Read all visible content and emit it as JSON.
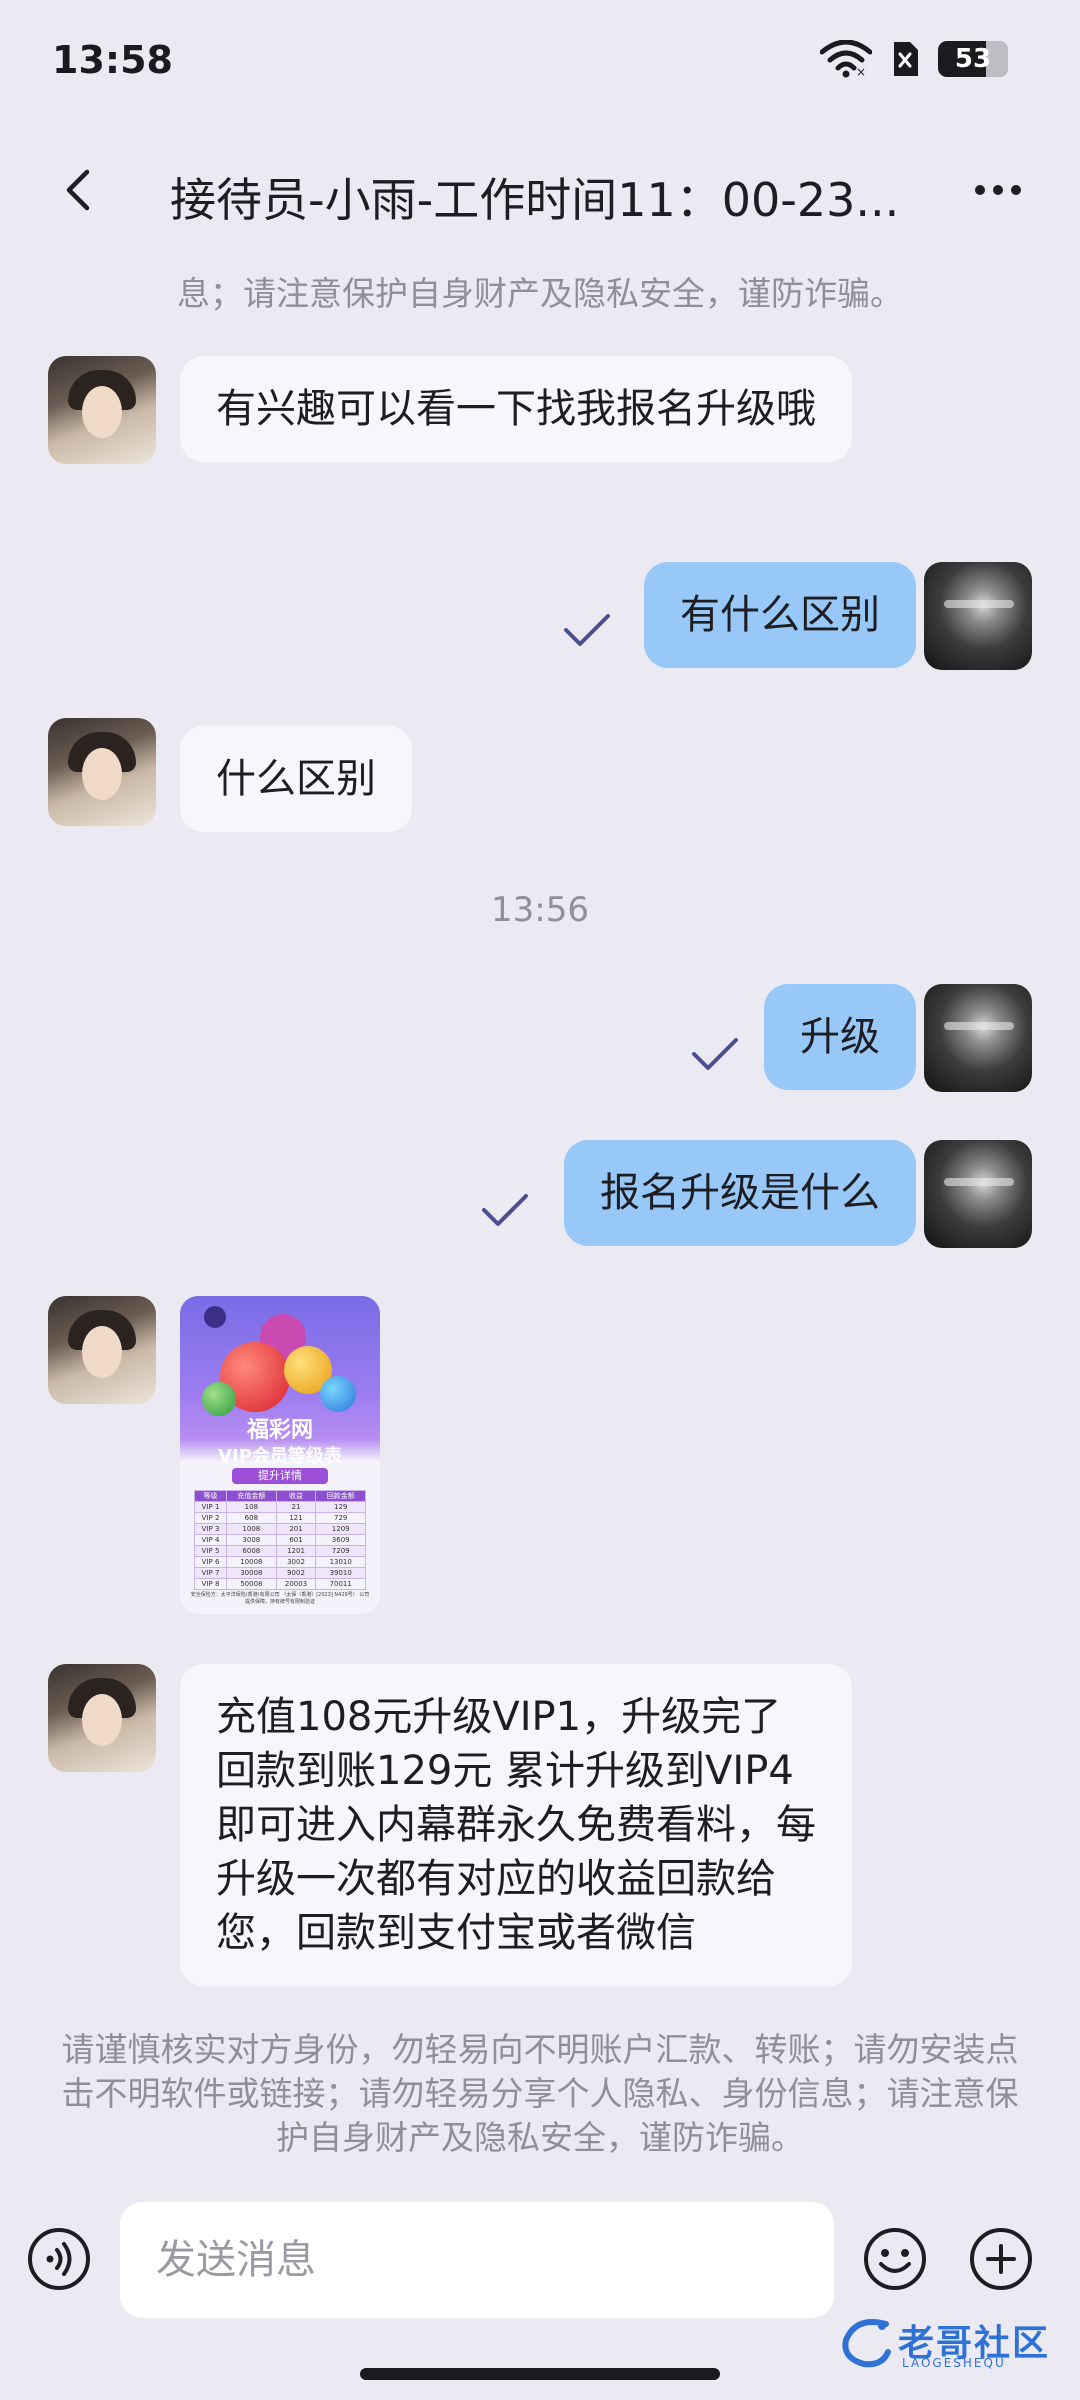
{
  "status_bar": {
    "time": "13:58",
    "battery": "53"
  },
  "header": {
    "title": "接待员-小雨-工作时间11：00-23..."
  },
  "notice_top": "息；请注意保护自身财产及隐私安全，谨防诈骗。",
  "messages": [
    {
      "side": "in",
      "text": "有兴趣可以看一下找我报名升级哦"
    },
    {
      "side": "out",
      "text": "有什么区别"
    },
    {
      "side": "in",
      "text": "什么区别"
    },
    {
      "side": "out",
      "text": "升级"
    },
    {
      "side": "out",
      "text": "报名升级是什么"
    },
    {
      "side": "in",
      "text": "充值108元升级VIP1，升级完了回款到账129元 累计升级到VIP4即可进入内幕群永久免费看料，每升级一次都有对应的收益回款给您，回款到支付宝或者微信"
    }
  ],
  "time_separator": "13:56",
  "image_message": {
    "title": "福彩网",
    "subtitle": "VIP会员等级表",
    "tag": "提升详情",
    "table_headers": [
      "等级",
      "充值金额",
      "收益",
      "回款金额"
    ],
    "table_rows": [
      [
        "VIP 1",
        "108",
        "21",
        "129"
      ],
      [
        "VIP 2",
        "608",
        "121",
        "729"
      ],
      [
        "VIP 3",
        "1008",
        "201",
        "1209"
      ],
      [
        "VIP 4",
        "3008",
        "601",
        "3609"
      ],
      [
        "VIP 5",
        "6008",
        "1201",
        "7209"
      ],
      [
        "VIP 6",
        "10008",
        "3002",
        "13010"
      ],
      [
        "VIP 7",
        "30008",
        "9002",
        "39010"
      ],
      [
        "VIP 8",
        "50008",
        "20003",
        "70011"
      ]
    ],
    "footer": "安全保险方：太平洋保险(香港)有限公司 （太保（香港）[2023] N429号） 公司提供保障，持有牌号有限制验证"
  },
  "notice_bottom": "请谨慎核实对方身份，勿轻易向不明账户汇款、转账；请勿安装点击不明软件或链接；请勿轻易分享个人隐私、身份信息；请注意保护自身财产及隐私安全，谨防诈骗。",
  "input": {
    "placeholder": "发送消息"
  },
  "watermark": {
    "text": "老哥社区",
    "sub": "LAOGESHEQU"
  }
}
